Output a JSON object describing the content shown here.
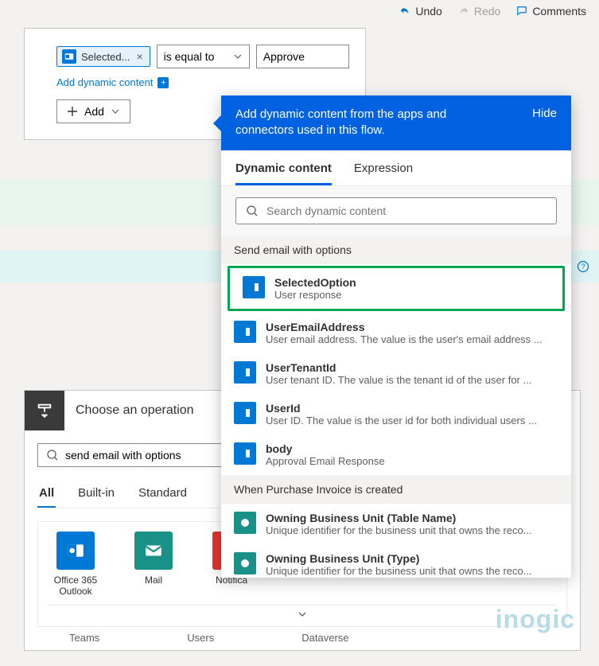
{
  "toolbar": {
    "undo": "Undo",
    "redo": "Redo",
    "comments": "Comments"
  },
  "condition": {
    "pill_label": "Selected...",
    "operator": "is equal to",
    "value": "Approve",
    "add_dynamic": "Add dynamic content",
    "add_button": "Add"
  },
  "op_panel": {
    "title": "Choose an operation",
    "search_value": "send email with options",
    "tabs": [
      "All",
      "Built-in",
      "Standard"
    ],
    "connectors": [
      {
        "label": "Office 365 Outlook",
        "color": "blue",
        "icon": "outlook"
      },
      {
        "label": "Mail",
        "color": "teal",
        "icon": "mail"
      },
      {
        "label": "Notifica",
        "color": "red",
        "icon": "bell"
      }
    ],
    "subtabs": [
      "Teams",
      "Users",
      "Dataverse"
    ],
    "seemore": "See more"
  },
  "flyout": {
    "banner": "Add dynamic content from the apps and connectors used in this flow.",
    "hide": "Hide",
    "tabs": {
      "dynamic": "Dynamic content",
      "expression": "Expression"
    },
    "search_placeholder": "Search dynamic content",
    "sections": [
      {
        "title": "Send email with options",
        "icon": "blue",
        "items": [
          {
            "title": "SelectedOption",
            "desc": "User response",
            "highlight": true
          },
          {
            "title": "UserEmailAddress",
            "desc": "User email address. The value is the user's email address ..."
          },
          {
            "title": "UserTenantId",
            "desc": "User tenant ID. The value is the tenant id of the user for ..."
          },
          {
            "title": "UserId",
            "desc": "User ID. The value is the user id for both individual users ..."
          },
          {
            "title": "body",
            "desc": "Approval Email Response"
          }
        ]
      },
      {
        "title": "When Purchase Invoice is created",
        "icon": "green",
        "items": [
          {
            "title": "Owning Business Unit (Table Name)",
            "desc": "Unique identifier for the business unit that owns the reco..."
          },
          {
            "title": "Owning Business Unit (Type)",
            "desc": "Unique identifier for the business unit that owns the reco..."
          }
        ]
      }
    ]
  },
  "watermark": "inogic"
}
